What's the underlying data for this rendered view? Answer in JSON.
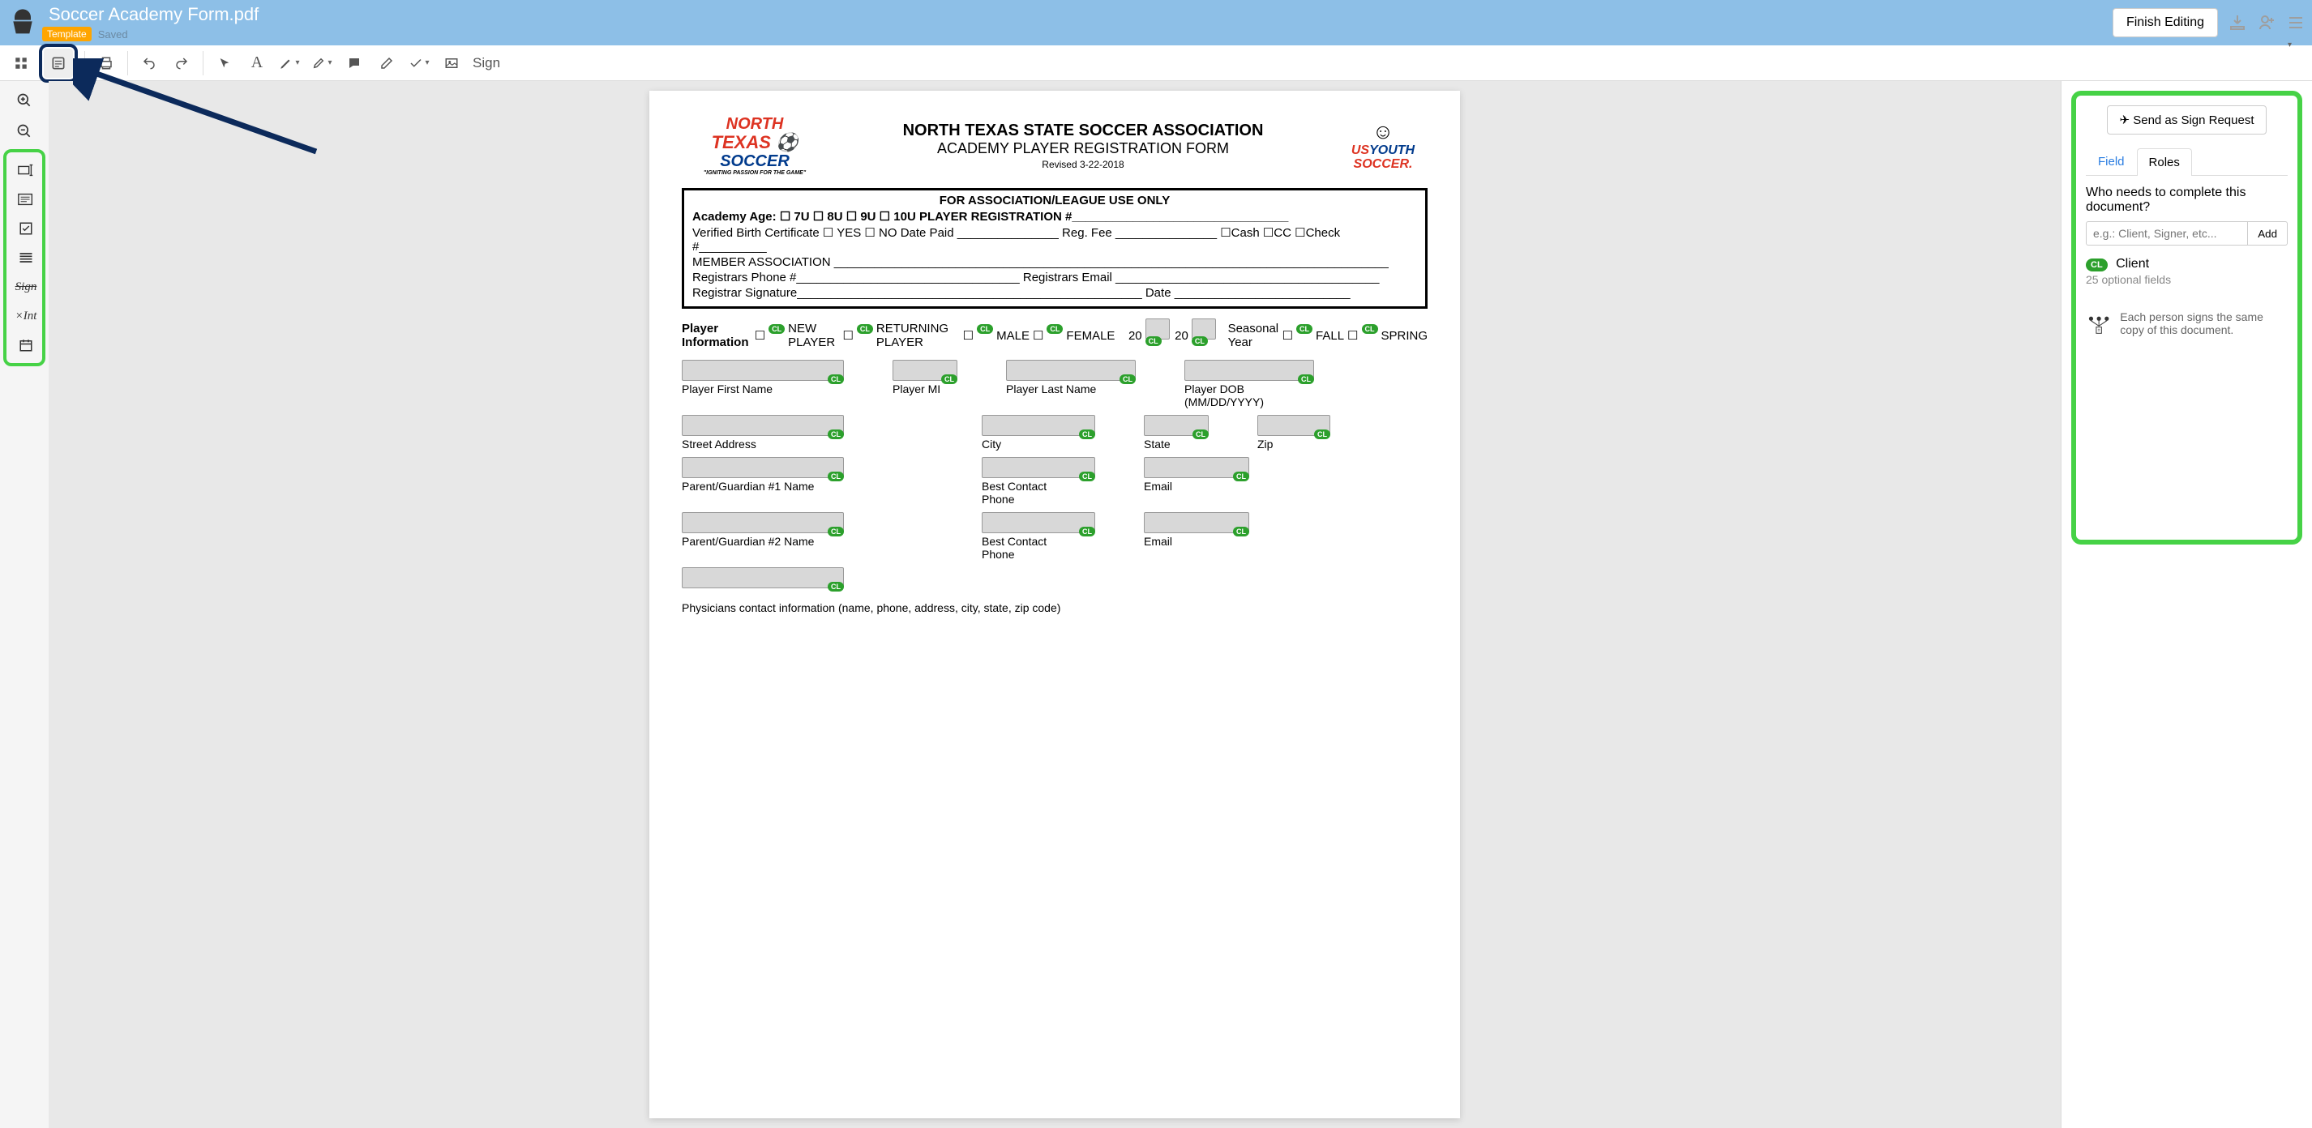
{
  "header": {
    "filename": "Soccer Academy Form.pdf",
    "template_badge": "Template",
    "saved": "Saved",
    "finish_btn": "Finish Editing"
  },
  "toolbar": {
    "sign": "Sign"
  },
  "doc": {
    "logo_north": "NORTH",
    "logo_texas": "TEXAS",
    "logo_soccer": "SOCCER",
    "logo_tagline": "\"IGNITING PASSION FOR THE GAME\"",
    "logo_us": "US",
    "logo_youth": "YOUTH",
    "logo_soccer2": "SOCCER.",
    "title1": "NORTH TEXAS STATE SOCCER ASSOCIATION",
    "title2": "ACADEMY PLAYER REGISTRATION FORM",
    "revised": "Revised  3-22-2018",
    "assoc_head": "FOR ASSOCIATION/LEAGUE USE ONLY",
    "assoc_age": "Academy Age:  ☐ 7U     ☐ 8U     ☐ 9U     ☐ 10U   PLAYER REGISTRATION #________________________________",
    "assoc_verified": "Verified Birth Certificate ☐ YES  ☐ NO    Date Paid _______________ Reg. Fee _______________ ☐Cash ☐CC ☐Check #__________",
    "assoc_member": "MEMBER ASSOCIATION __________________________________________________________________________________",
    "assoc_phone": "Registrars Phone #_________________________________  Registrars Email _______________________________________",
    "assoc_sig": "Registrar Signature___________________________________________________    Date __________________________",
    "pi_label": "Player Information",
    "pi_new": "NEW PLAYER",
    "pi_returning": "RETURNING PLAYER",
    "pi_male": "MALE",
    "pi_female": "FEMALE",
    "pi_20a": "20____",
    "pi_20b": "20____",
    "pi_season": "Seasonal Year",
    "pi_fall": "FALL",
    "pi_spring": "SPRING",
    "f_first": "Player First Name",
    "f_mi": "Player MI",
    "f_last": "Player Last Name",
    "f_dob": "Player DOB (MM/DD/YYYY)",
    "f_street": "Street Address",
    "f_city": "City",
    "f_state": "State",
    "f_zip": "Zip",
    "f_pg1": "Parent/Guardian #1 Name",
    "f_pg2": "Parent/Guardian #2 Name",
    "f_phone": "Best Contact Phone",
    "f_email": "Email",
    "f_phys": "Physicians contact information (name, phone, address, city, state, zip code)",
    "cl": "CL"
  },
  "right": {
    "send": "Send as Sign Request",
    "tab_field": "Field",
    "tab_roles": "Roles",
    "question": "Who needs to complete this document?",
    "placeholder": "e.g.: Client, Signer, etc...",
    "add": "Add",
    "role_code": "CL",
    "role_name": "Client",
    "role_sub": "25 optional fields",
    "note": "Each person signs the same copy of this document."
  }
}
